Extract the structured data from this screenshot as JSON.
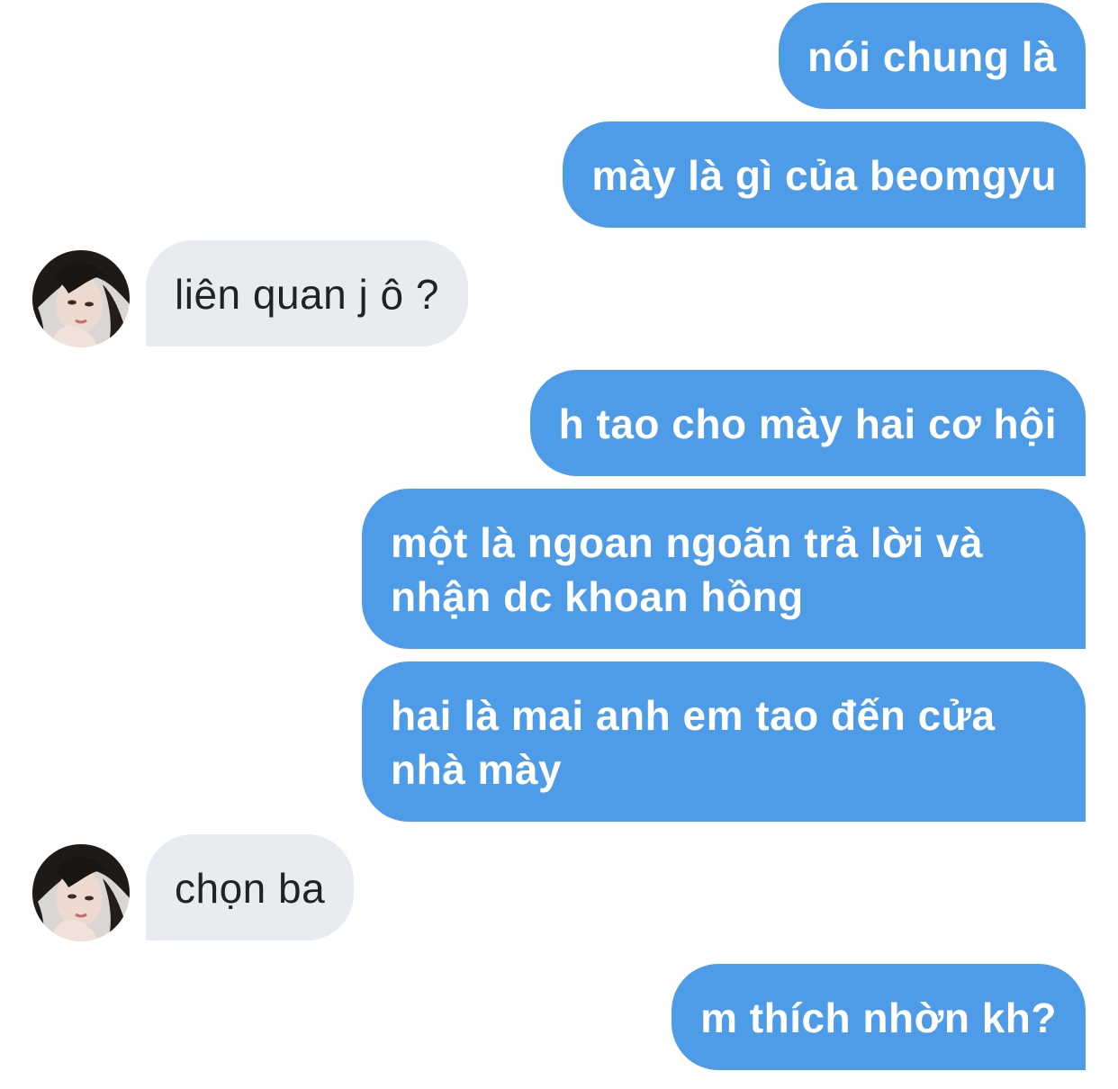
{
  "conversation": {
    "messages": [
      {
        "side": "sent",
        "text": "nói chung là"
      },
      {
        "side": "sent",
        "text": "mày là gì của beomgyu"
      },
      {
        "side": "received",
        "text": "liên quan j ô ?"
      },
      {
        "side": "sent",
        "text": "h tao cho mày hai cơ hội"
      },
      {
        "side": "sent",
        "text": "một là ngoan ngoãn trả lời và\nnhận dc khoan hồng"
      },
      {
        "side": "sent",
        "text": "hai là mai anh em tao đến cửa\nnhà mày"
      },
      {
        "side": "received",
        "text": "chọn ba"
      },
      {
        "side": "sent",
        "text": "m thích nhờn kh?"
      }
    ]
  },
  "colors": {
    "sent_bubble": "#4e9be8",
    "received_bubble": "#e8ebef",
    "background": "#ffffff"
  }
}
